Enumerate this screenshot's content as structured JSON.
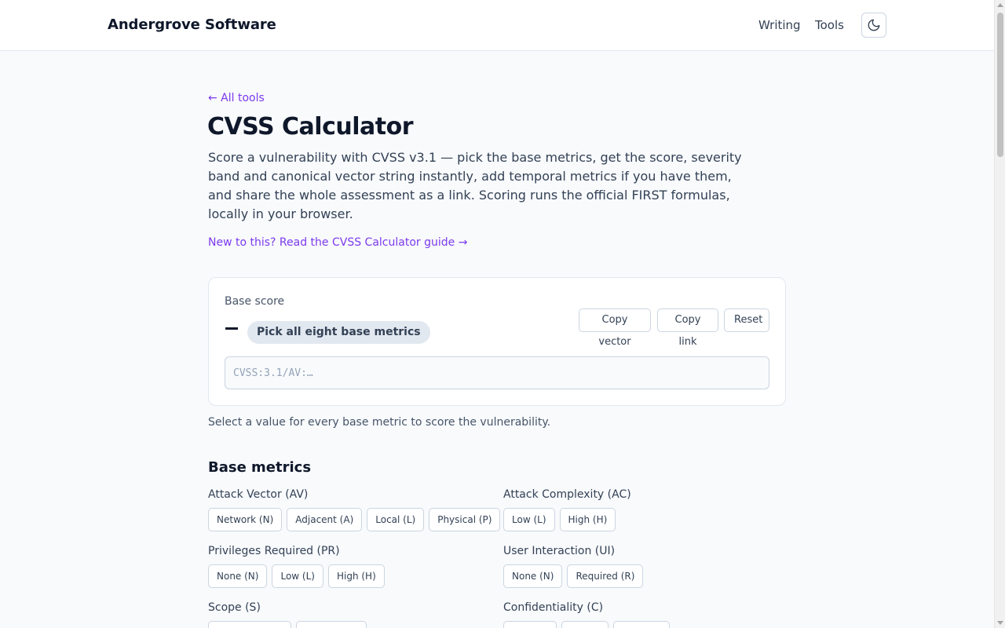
{
  "header": {
    "brand": "Andergrove Software",
    "nav": [
      "Writing",
      "Tools"
    ],
    "theme_icon": "moon-icon"
  },
  "back_link": "← All tools",
  "title": "CVSS Calculator",
  "intro": "Score a vulnerability with CVSS v3.1 — pick the base metrics, get the score, severity band and canonical vector string instantly, add temporal metrics if you have them, and share the whole assessment as a link. Scoring runs the official FIRST formulas, locally in your browser.",
  "guide_link": "New to this? Read the CVSS Calculator guide →",
  "score_card": {
    "label": "Base score",
    "severity": "Pick all eight base metrics",
    "buttons": {
      "copy_vector": "Copy vector",
      "copy_link": "Copy link",
      "reset": "Reset"
    },
    "vector_placeholder": "CVSS:3.1/AV:…"
  },
  "hint": "Select a value for every base metric to score the vulnerability.",
  "base_metrics": {
    "title": "Base metrics",
    "attack_vector": {
      "label": "Attack Vector (AV)",
      "options": [
        "Network (N)",
        "Adjacent (A)",
        "Local (L)",
        "Physical (P)"
      ]
    },
    "attack_complexity": {
      "label": "Attack Complexity (AC)",
      "options": [
        "Low (L)",
        "High (H)"
      ]
    },
    "privileges_required": {
      "label": "Privileges Required (PR)",
      "options": [
        "None (N)",
        "Low (L)",
        "High (H)"
      ]
    },
    "user_interaction": {
      "label": "User Interaction (UI)",
      "options": [
        "None (N)",
        "Required (R)"
      ]
    },
    "scope": {
      "label": "Scope (S)"
    },
    "confidentiality": {
      "label": "Confidentiality (C)"
    }
  }
}
